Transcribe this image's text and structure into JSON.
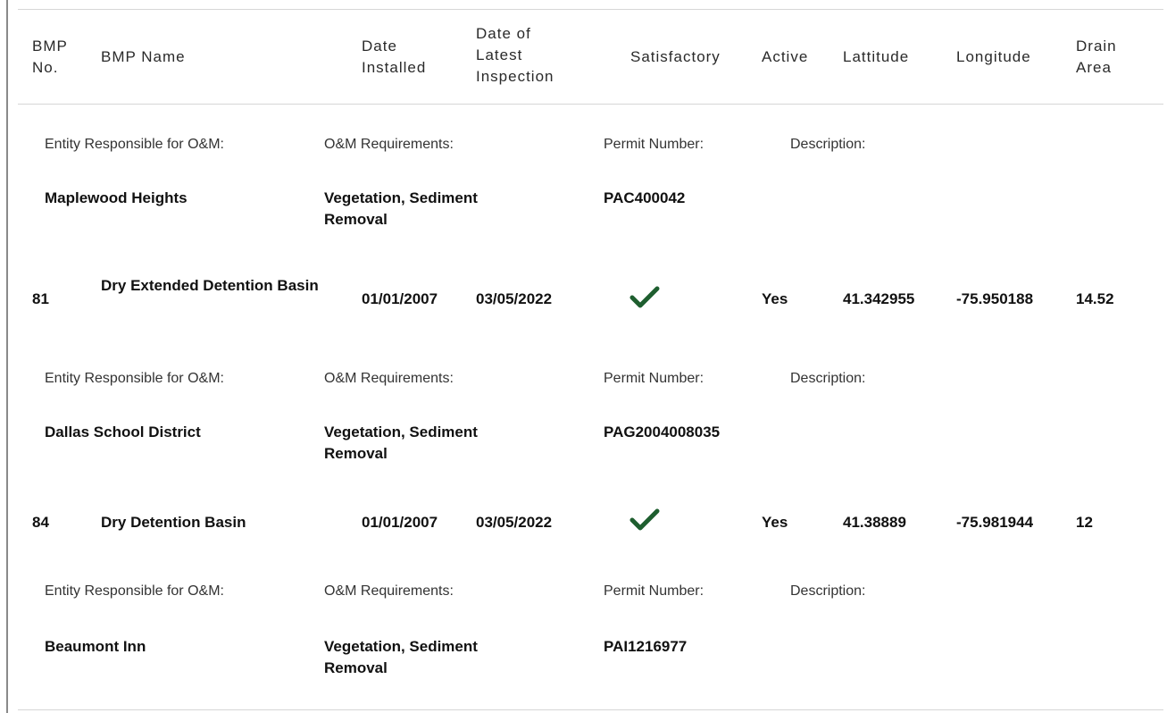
{
  "header": {
    "bmp_no": "BMP\nNo.",
    "bmp_name": "BMP Name",
    "date_installed": "Date\nInstalled",
    "date_latest_inspection": "Date of\nLatest\nInspection",
    "satisfactory": "Satisfactory",
    "active": "Active",
    "latitude": "Lattitude",
    "longitude": "Longitude",
    "drain_area": "Drain\nArea"
  },
  "detail_labels": {
    "entity": "Entity Responsible for O&M:",
    "requirements": "O&M Requirements:",
    "permit": "Permit Number:",
    "description": "Description:"
  },
  "details": [
    {
      "entity": "Maplewood Heights",
      "requirements": "Vegetation, Sediment Removal",
      "permit": "PAC400042",
      "description": ""
    },
    {
      "entity": "Dallas School District",
      "requirements": "Vegetation, Sediment Removal",
      "permit": "PAG2004008035",
      "description": ""
    },
    {
      "entity": "Beaumont Inn",
      "requirements": "Vegetation, Sediment Removal",
      "permit": "PAI1216977",
      "description": ""
    }
  ],
  "rows": [
    {
      "bmp_no": "81",
      "bmp_name": "Dry Extended Detention Basin",
      "date_installed": "01/01/2007",
      "date_latest_inspection": "03/05/2022",
      "satisfactory_icon": "checkmark-icon",
      "active": "Yes",
      "latitude": "41.342955",
      "longitude": "-75.950188",
      "drain_area": "14.52"
    },
    {
      "bmp_no": "84",
      "bmp_name": "Dry Detention Basin",
      "date_installed": "01/01/2007",
      "date_latest_inspection": "03/05/2022",
      "satisfactory_icon": "checkmark-icon",
      "active": "Yes",
      "latitude": "41.38889",
      "longitude": "-75.981944",
      "drain_area": "12"
    }
  ],
  "colors": {
    "check": "#1e5e2f",
    "rule": "#d6d6d6"
  }
}
